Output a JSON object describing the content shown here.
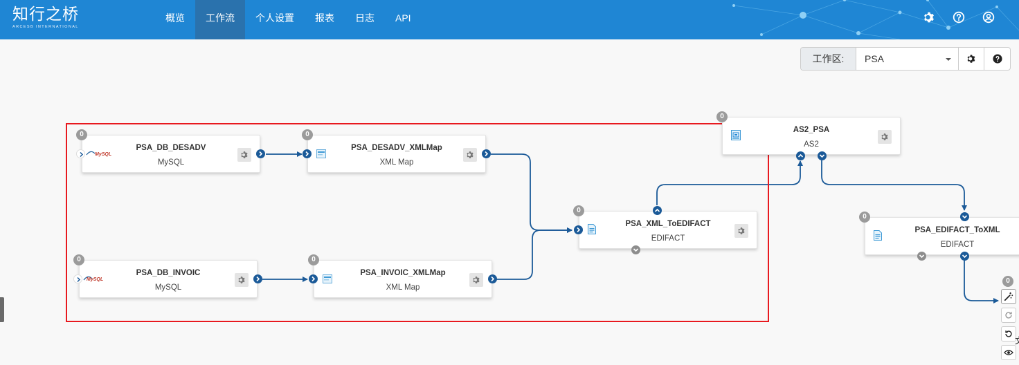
{
  "header": {
    "logo": "知行之桥",
    "logo_sub": "ARCESB INTERNATIONAL",
    "nav": [
      "概览",
      "工作流",
      "个人设置",
      "报表",
      "日志",
      "API"
    ],
    "active_nav": "工作流"
  },
  "workspace": {
    "label": "工作区:",
    "selected": "PSA"
  },
  "nodes": [
    {
      "name": "PSA_DB_DESADV",
      "type": "MySQL",
      "badge": "0"
    },
    {
      "name": "PSA_DESADV_XMLMap",
      "type": "XML Map",
      "badge": "0"
    },
    {
      "name": "PSA_DB_INVOIC",
      "type": "MySQL",
      "badge": "0"
    },
    {
      "name": "PSA_INVOIC_XMLMap",
      "type": "XML Map",
      "badge": "0"
    },
    {
      "name": "PSA_XML_ToEDIFACT",
      "type": "EDIFACT",
      "badge": "0"
    },
    {
      "name": "AS2_PSA",
      "type": "AS2",
      "badge": "0"
    },
    {
      "name": "PSA_EDIFACT_ToXML",
      "type": "EDIFACT",
      "badge": "0"
    },
    {
      "name": "",
      "type": "",
      "badge": "0"
    }
  ],
  "mysql_icon_text": "MySQL",
  "right_cut_text": "文",
  "colors": {
    "header_bg": "#1f86d4",
    "nav_active_bg": "#2a72ad",
    "edge": "#1b5a98",
    "selection": "#e8191f",
    "badge": "#9b9b9b"
  },
  "icons": [
    "gear-icon",
    "help-icon",
    "user-icon",
    "chevron-right-icon",
    "chevron-up-icon",
    "chevron-down-icon",
    "magic-wand-icon",
    "redo-icon",
    "undo-icon",
    "eye-icon"
  ]
}
